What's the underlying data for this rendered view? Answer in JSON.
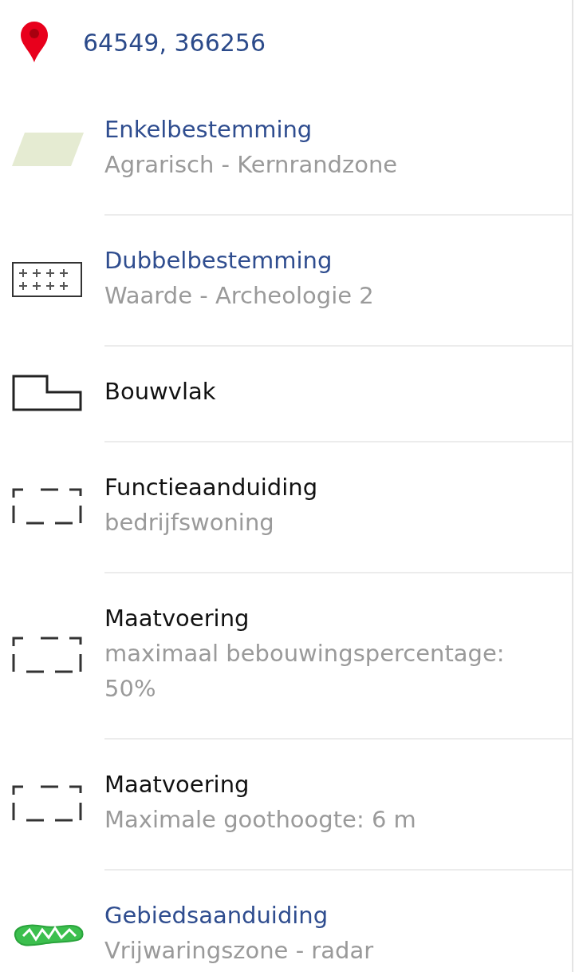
{
  "location": {
    "coordinates": "64549, 366256"
  },
  "items": [
    {
      "kind": "fill",
      "title": "Enkelbestemming",
      "link": true,
      "subtitle": "Agrarisch - Kernrandzone"
    },
    {
      "kind": "crosses",
      "title": "Dubbelbestemming",
      "link": true,
      "subtitle": "Waarde - Archeologie 2"
    },
    {
      "kind": "outline",
      "title": "Bouwvlak",
      "link": false
    },
    {
      "kind": "dashed",
      "title": "Functieaanduiding",
      "link": false,
      "subtitle": "bedrijfswoning"
    },
    {
      "kind": "dashed",
      "title": "Maatvoering",
      "link": false,
      "subtitle": "maximaal bebouwingspercentage: 50%"
    },
    {
      "kind": "dashed",
      "title": "Maatvoering",
      "link": false,
      "subtitle": "Maximale goothoogte: 6 m"
    },
    {
      "kind": "zone",
      "title": "Gebiedsaanduiding",
      "link": true,
      "subtitle": "Vrijwaringszone - radar"
    }
  ]
}
